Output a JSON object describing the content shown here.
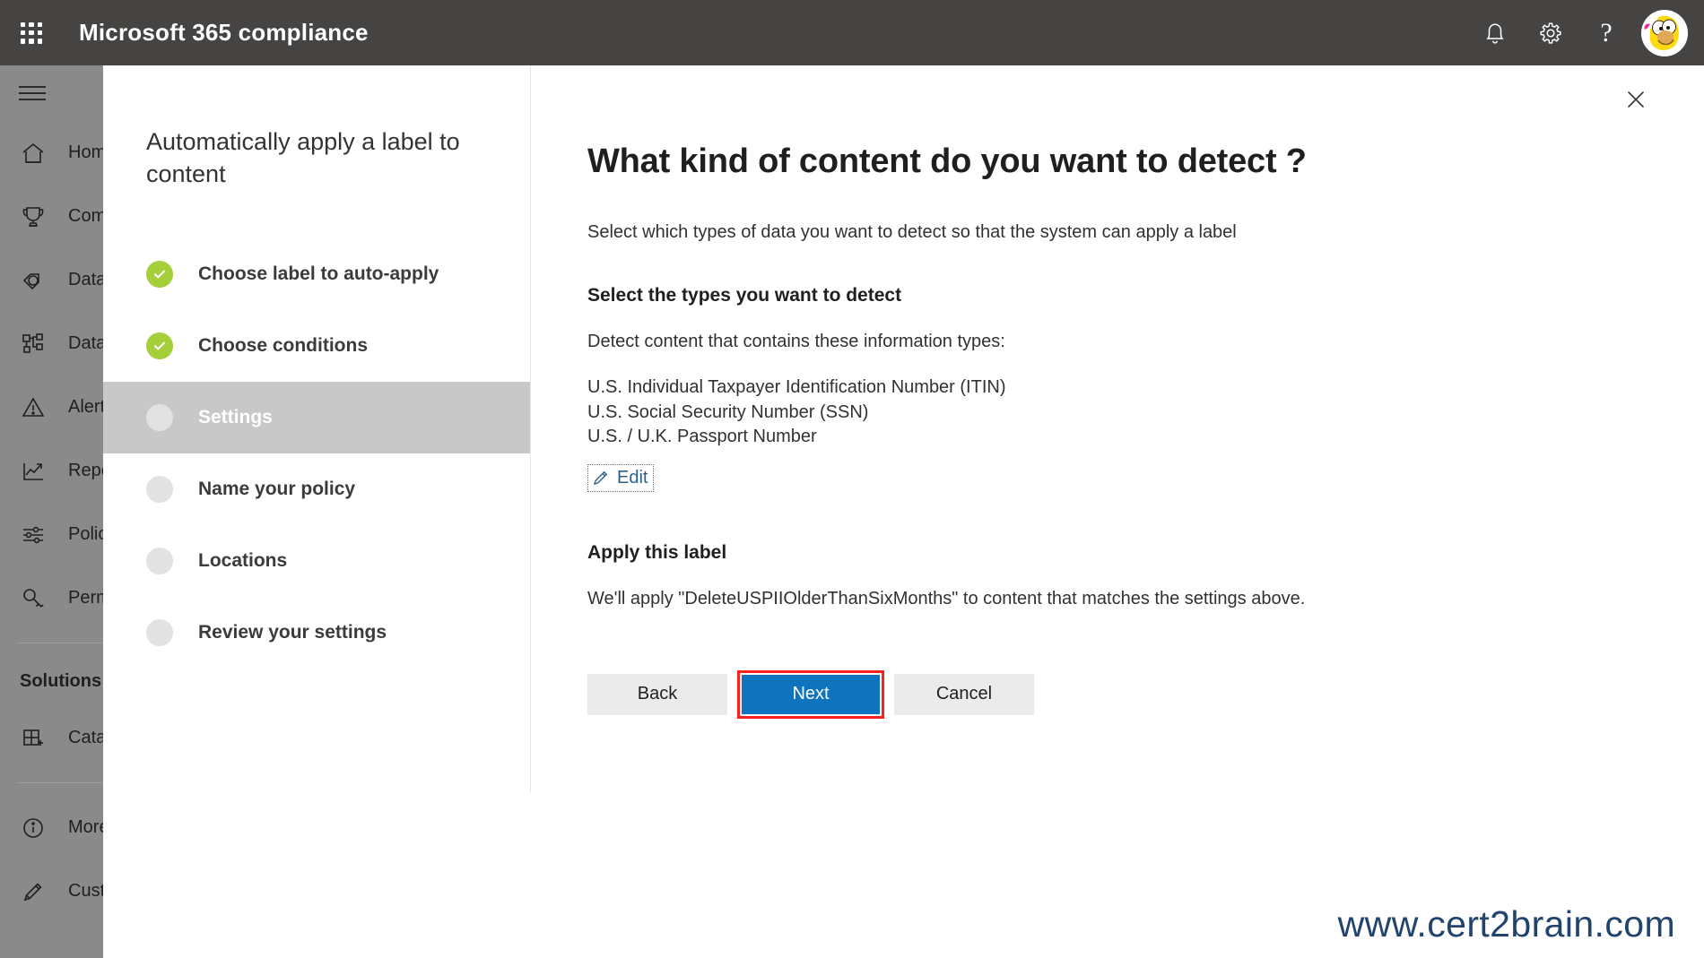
{
  "suite": {
    "waffle_icon": "app-launcher-icon",
    "title": "Microsoft 365 compliance",
    "notifications_icon": "bell-icon",
    "settings_icon": "gear-icon",
    "help_icon": "question-mark-icon",
    "avatar_icon": "user-avatar"
  },
  "rail": {
    "menu_icon": "hamburger-menu-icon",
    "items": [
      {
        "label": "Home",
        "icon": "home-icon"
      },
      {
        "label": "Compliance",
        "icon": "trophy-icon"
      },
      {
        "label": "Data classification",
        "icon": "tag-icon"
      },
      {
        "label": "Data investigations",
        "icon": "hierarchy-icon"
      },
      {
        "label": "Alerts",
        "icon": "warning-triangle-icon"
      },
      {
        "label": "Reports",
        "icon": "line-chart-icon"
      },
      {
        "label": "Policies",
        "icon": "sliders-icon"
      },
      {
        "label": "Permissions",
        "icon": "key-icon"
      }
    ],
    "group_label": "Solutions",
    "solutions": [
      {
        "label": "Catalog",
        "icon": "catalog-grid-plus-icon"
      }
    ],
    "footer": [
      {
        "label": "More resources",
        "icon": "info-circle-icon"
      },
      {
        "label": "Customize navigation",
        "icon": "pencil-icon"
      }
    ]
  },
  "wizard": {
    "title": "Automatically apply a label to content",
    "steps": [
      {
        "label": "Choose label to auto-apply",
        "state": "done"
      },
      {
        "label": "Choose conditions",
        "state": "done"
      },
      {
        "label": "Settings",
        "state": "active"
      },
      {
        "label": "Name your policy",
        "state": "pending"
      },
      {
        "label": "Locations",
        "state": "pending"
      },
      {
        "label": "Review your settings",
        "state": "pending"
      }
    ]
  },
  "main": {
    "close_icon": "close-icon",
    "title": "What kind of content do you want to detect ?",
    "subtitle": "Select which types of data you want to detect so that the system can apply a label",
    "types_heading": "Select the types you want to detect",
    "types_intro": "Detect content that contains these information types:",
    "types": [
      "U.S. Individual Taxpayer Identification Number (ITIN)",
      "U.S. Social Security Number (SSN)",
      "U.S. / U.K. Passport Number"
    ],
    "edit_label": "Edit",
    "edit_icon": "pencil-icon",
    "apply_heading": "Apply this label",
    "apply_text": "We'll apply \"DeleteUSPIIOlderThanSixMonths\" to content that matches the settings above.",
    "buttons": {
      "back": "Back",
      "next": "Next",
      "cancel": "Cancel"
    }
  },
  "watermark": "www.cert2brain.com",
  "colors": {
    "suite_bar": "#464443",
    "rail": "#8a8a8a",
    "primary_button": "#0f74bd",
    "step_done": "#a4cf38",
    "step_active_bg": "#c8c8c8",
    "highlight": "#fc1f1f",
    "link": "#2d5f8b",
    "watermark": "#21436e"
  }
}
